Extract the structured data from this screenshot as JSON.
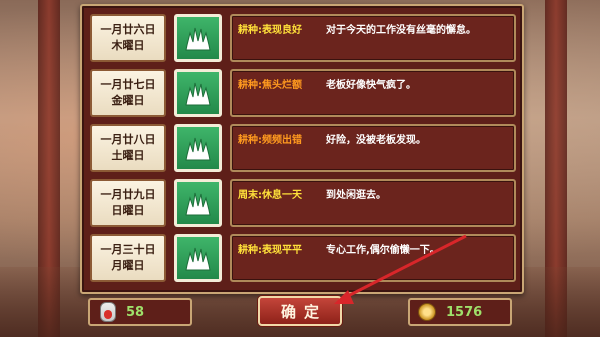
{
  "colors": {
    "tag_orange": "#ff9a1f",
    "tag_yellow": "#ffe13a",
    "value_green": "#9fe06a",
    "arrow_red": "#d8262a"
  },
  "rows": [
    {
      "date": "一月廿六日",
      "weekday": "木曜日",
      "icon": "grass-icon",
      "tag": "耕种:表现良好",
      "tag_color": "#ffe13a",
      "text": "对于今天的工作没有丝毫的懈怠。"
    },
    {
      "date": "一月廿七日",
      "weekday": "金曜日",
      "icon": "grass-icon",
      "tag": "耕种:焦头烂额",
      "tag_color": "#ff9a1f",
      "text": "老板好像快气疯了。"
    },
    {
      "date": "一月廿八日",
      "weekday": "土曜日",
      "icon": "grass-icon",
      "tag": "耕种:频频出错",
      "tag_color": "#ff9a1f",
      "text": "好险，没被老板发现。"
    },
    {
      "date": "一月廿九日",
      "weekday": "日曜日",
      "icon": "grass-icon",
      "tag": "周末:休息一天",
      "tag_color": "#ffe13a",
      "text": "到处闲逛去。"
    },
    {
      "date": "一月三十日",
      "weekday": "月曜日",
      "icon": "grass-icon",
      "tag": "耕种:表现平平",
      "tag_color": "#ffe13a",
      "text": "专心工作,偶尔偷懒一下。"
    }
  ],
  "health": {
    "icon": "potion-vial-icon",
    "value": "58"
  },
  "confirm_label": "确定",
  "money": {
    "icon": "coin-icon",
    "value": "1576"
  }
}
